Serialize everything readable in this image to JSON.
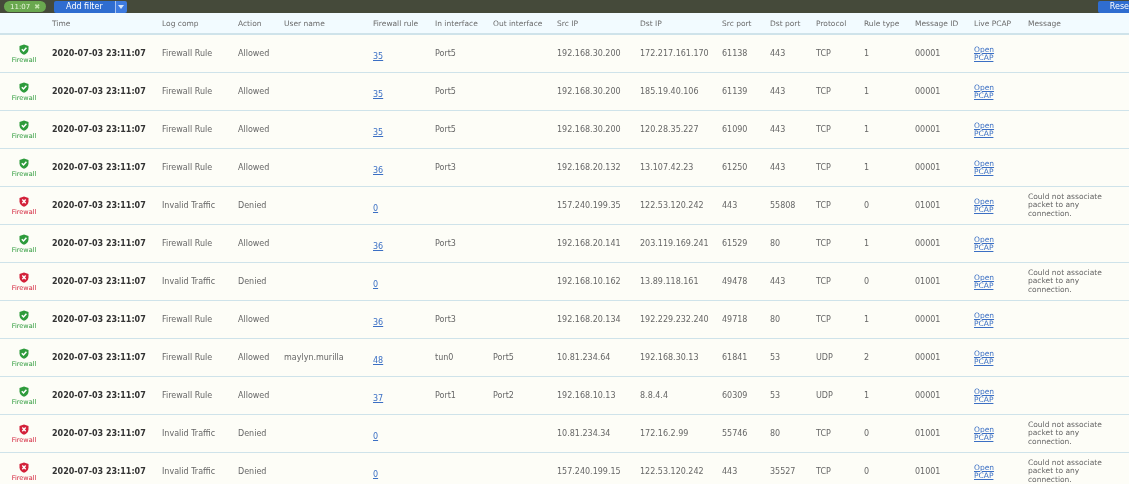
{
  "toolbar": {
    "filter_chip": {
      "label": "11:07",
      "remove": "✖"
    },
    "add_filter": "Add filter",
    "reset": "Rese"
  },
  "columns": [
    "Time",
    "Log comp",
    "Action",
    "User name",
    "Firewall rule",
    "In interface",
    "Out interface",
    "Src IP",
    "Dst IP",
    "Src port",
    "Dst port",
    "Protocol",
    "Rule type",
    "Message ID",
    "Live PCAP",
    "Message"
  ],
  "rows": [
    {
      "kind": "allowed",
      "source": "Firewall",
      "time": "2020-07-03 23:11:07",
      "log_comp": "Firewall Rule",
      "action": "Allowed",
      "user": "",
      "rule": "35",
      "in": "Port5",
      "out": "",
      "src_ip": "192.168.30.200",
      "dst_ip": "172.217.161.170",
      "src_port": "61138",
      "dst_port": "443",
      "protocol": "TCP",
      "rule_type": "1",
      "message_id": "00001",
      "pcap": "Open PCAP",
      "message": ""
    },
    {
      "kind": "allowed",
      "source": "Firewall",
      "time": "2020-07-03 23:11:07",
      "log_comp": "Firewall Rule",
      "action": "Allowed",
      "user": "",
      "rule": "35",
      "in": "Port5",
      "out": "",
      "src_ip": "192.168.30.200",
      "dst_ip": "185.19.40.106",
      "src_port": "61139",
      "dst_port": "443",
      "protocol": "TCP",
      "rule_type": "1",
      "message_id": "00001",
      "pcap": "Open PCAP",
      "message": ""
    },
    {
      "kind": "allowed",
      "source": "Firewall",
      "time": "2020-07-03 23:11:07",
      "log_comp": "Firewall Rule",
      "action": "Allowed",
      "user": "",
      "rule": "35",
      "in": "Port5",
      "out": "",
      "src_ip": "192.168.30.200",
      "dst_ip": "120.28.35.227",
      "src_port": "61090",
      "dst_port": "443",
      "protocol": "TCP",
      "rule_type": "1",
      "message_id": "00001",
      "pcap": "Open PCAP",
      "message": ""
    },
    {
      "kind": "allowed",
      "source": "Firewall",
      "time": "2020-07-03 23:11:07",
      "log_comp": "Firewall Rule",
      "action": "Allowed",
      "user": "",
      "rule": "36",
      "in": "Port3",
      "out": "",
      "src_ip": "192.168.20.132",
      "dst_ip": "13.107.42.23",
      "src_port": "61250",
      "dst_port": "443",
      "protocol": "TCP",
      "rule_type": "1",
      "message_id": "00001",
      "pcap": "Open PCAP",
      "message": ""
    },
    {
      "kind": "denied",
      "source": "Firewall",
      "time": "2020-07-03 23:11:07",
      "log_comp": "Invalid Traffic",
      "action": "Denied",
      "user": "",
      "rule": "0",
      "in": "",
      "out": "",
      "src_ip": "157.240.199.35",
      "dst_ip": "122.53.120.242",
      "src_port": "443",
      "dst_port": "55808",
      "protocol": "TCP",
      "rule_type": "0",
      "message_id": "01001",
      "pcap": "Open PCAP",
      "message": "Could not associate packet to any connection."
    },
    {
      "kind": "allowed",
      "source": "Firewall",
      "time": "2020-07-03 23:11:07",
      "log_comp": "Firewall Rule",
      "action": "Allowed",
      "user": "",
      "rule": "36",
      "in": "Port3",
      "out": "",
      "src_ip": "192.168.20.141",
      "dst_ip": "203.119.169.241",
      "src_port": "61529",
      "dst_port": "80",
      "protocol": "TCP",
      "rule_type": "1",
      "message_id": "00001",
      "pcap": "Open PCAP",
      "message": ""
    },
    {
      "kind": "denied",
      "source": "Firewall",
      "time": "2020-07-03 23:11:07",
      "log_comp": "Invalid Traffic",
      "action": "Denied",
      "user": "",
      "rule": "0",
      "in": "",
      "out": "",
      "src_ip": "192.168.10.162",
      "dst_ip": "13.89.118.161",
      "src_port": "49478",
      "dst_port": "443",
      "protocol": "TCP",
      "rule_type": "0",
      "message_id": "01001",
      "pcap": "Open PCAP",
      "message": "Could not associate packet to any connection."
    },
    {
      "kind": "allowed",
      "source": "Firewall",
      "time": "2020-07-03 23:11:07",
      "log_comp": "Firewall Rule",
      "action": "Allowed",
      "user": "",
      "rule": "36",
      "in": "Port3",
      "out": "",
      "src_ip": "192.168.20.134",
      "dst_ip": "192.229.232.240",
      "src_port": "49718",
      "dst_port": "80",
      "protocol": "TCP",
      "rule_type": "1",
      "message_id": "00001",
      "pcap": "Open PCAP",
      "message": ""
    },
    {
      "kind": "allowed",
      "source": "Firewall",
      "time": "2020-07-03 23:11:07",
      "log_comp": "Firewall Rule",
      "action": "Allowed",
      "user": "maylyn.murilla",
      "rule": "48",
      "in": "tun0",
      "out": "Port5",
      "src_ip": "10.81.234.64",
      "dst_ip": "192.168.30.13",
      "src_port": "61841",
      "dst_port": "53",
      "protocol": "UDP",
      "rule_type": "2",
      "message_id": "00001",
      "pcap": "Open PCAP",
      "message": ""
    },
    {
      "kind": "allowed",
      "source": "Firewall",
      "time": "2020-07-03 23:11:07",
      "log_comp": "Firewall Rule",
      "action": "Allowed",
      "user": "",
      "rule": "37",
      "in": "Port1",
      "out": "Port2",
      "src_ip": "192.168.10.13",
      "dst_ip": "8.8.4.4",
      "src_port": "60309",
      "dst_port": "53",
      "protocol": "UDP",
      "rule_type": "1",
      "message_id": "00001",
      "pcap": "Open PCAP",
      "message": ""
    },
    {
      "kind": "denied",
      "source": "Firewall",
      "time": "2020-07-03 23:11:07",
      "log_comp": "Invalid Traffic",
      "action": "Denied",
      "user": "",
      "rule": "0",
      "in": "",
      "out": "",
      "src_ip": "10.81.234.34",
      "dst_ip": "172.16.2.99",
      "src_port": "55746",
      "dst_port": "80",
      "protocol": "TCP",
      "rule_type": "0",
      "message_id": "01001",
      "pcap": "Open PCAP",
      "message": "Could not associate packet to any connection."
    },
    {
      "kind": "denied",
      "source": "Firewall",
      "time": "2020-07-03 23:11:07",
      "log_comp": "Invalid Traffic",
      "action": "Denied",
      "user": "",
      "rule": "0",
      "in": "",
      "out": "",
      "src_ip": "157.240.199.15",
      "dst_ip": "122.53.120.242",
      "src_port": "443",
      "dst_port": "35527",
      "protocol": "TCP",
      "rule_type": "0",
      "message_id": "01001",
      "pcap": "Open PCAP",
      "message": "Could not associate packet to any connection."
    }
  ]
}
